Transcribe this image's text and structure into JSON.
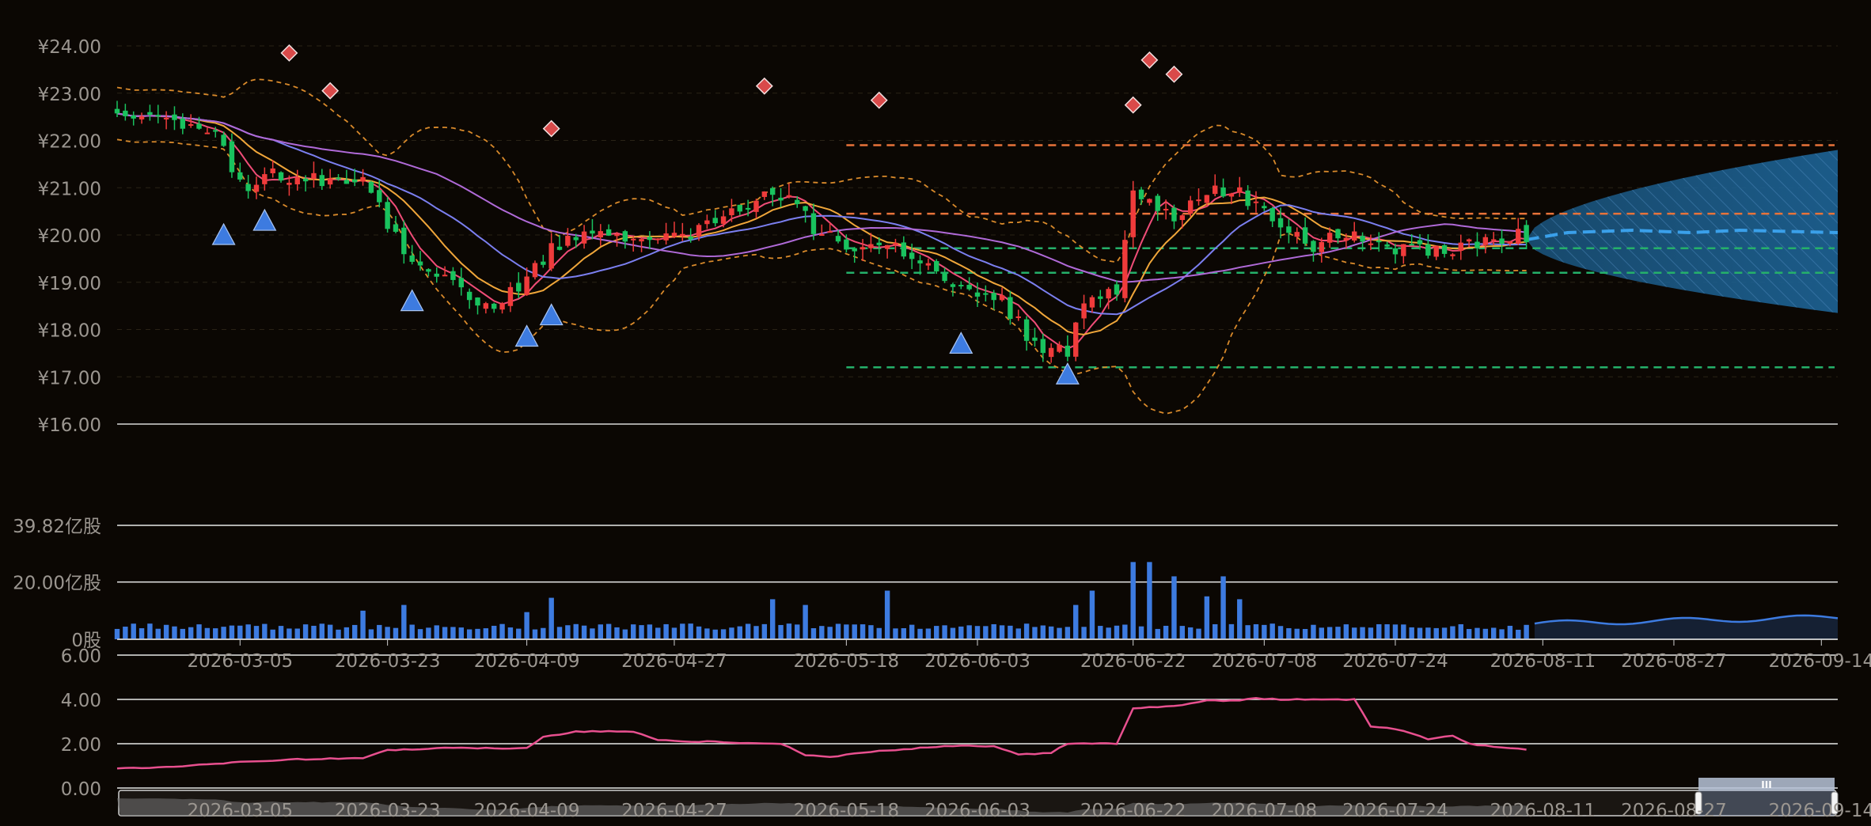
{
  "chart_data": [
    {
      "type": "candlestick",
      "panel": "price",
      "y_tick_labels": [
        "¥24.00",
        "¥23.00",
        "¥22.00",
        "¥21.00",
        "¥20.00",
        "¥19.00",
        "¥18.00",
        "¥17.00",
        "¥16.00"
      ],
      "ylim": [
        16,
        24
      ],
      "date_start": "2026-02-18",
      "date_end": "2026-09-16",
      "last_candle_date": "2026-08-09",
      "anchors": [
        [
          "2026-02-18",
          22.7
        ],
        [
          "2026-02-24",
          22.5
        ],
        [
          "2026-03-01",
          22.3
        ],
        [
          "2026-03-04",
          21.5
        ],
        [
          "2026-03-06",
          21.1
        ],
        [
          "2026-03-10",
          21.3
        ],
        [
          "2026-03-14",
          21.2
        ],
        [
          "2026-03-20",
          21.2
        ],
        [
          "2026-03-23",
          20.2
        ],
        [
          "2026-03-27",
          19.2
        ],
        [
          "2026-04-01",
          18.9
        ],
        [
          "2026-04-05",
          18.4
        ],
        [
          "2026-04-08",
          18.9
        ],
        [
          "2026-04-12",
          19.7
        ],
        [
          "2026-04-16",
          20.0
        ],
        [
          "2026-04-22",
          20.0
        ],
        [
          "2026-04-27",
          19.9
        ],
        [
          "2026-05-03",
          20.4
        ],
        [
          "2026-05-07",
          20.8
        ],
        [
          "2026-05-11",
          20.9
        ],
        [
          "2026-05-14",
          20.1
        ],
        [
          "2026-05-18",
          19.8
        ],
        [
          "2026-05-22",
          19.8
        ],
        [
          "2026-05-27",
          19.5
        ],
        [
          "2026-06-01",
          18.9
        ],
        [
          "2026-06-06",
          18.6
        ],
        [
          "2026-06-10",
          17.7
        ],
        [
          "2026-06-14",
          17.6
        ],
        [
          "2026-06-17",
          18.8
        ],
        [
          "2026-06-20",
          18.8
        ],
        [
          "2026-06-22",
          20.8
        ],
        [
          "2026-06-27",
          20.3
        ],
        [
          "2026-07-01",
          20.9
        ],
        [
          "2026-07-05",
          20.9
        ],
        [
          "2026-07-09",
          20.4
        ],
        [
          "2026-07-14",
          19.8
        ],
        [
          "2026-07-19",
          20.0
        ],
        [
          "2026-07-24",
          19.7
        ],
        [
          "2026-07-29",
          19.6
        ],
        [
          "2026-08-04",
          19.9
        ],
        [
          "2026-08-09",
          20.0
        ]
      ],
      "up_color": "#ef3b3b",
      "down_color": "#19c25e",
      "moving_average_colors": [
        "#f04d78",
        "#f0a63a",
        "#7b7ff0",
        "#b06ad8"
      ],
      "bollinger_color": "#d98a2b",
      "horizontal_levels": [
        {
          "value": 21.9,
          "color": "#e8733a",
          "from": "2026-05-18"
        },
        {
          "value": 20.45,
          "color": "#e8733a",
          "from": "2026-05-18"
        },
        {
          "value": 19.72,
          "color": "#25b06a",
          "from": "2026-05-18"
        },
        {
          "value": 19.2,
          "color": "#25b06a",
          "from": "2026-05-18"
        },
        {
          "value": 17.2,
          "color": "#25b06a",
          "from": "2026-05-18"
        }
      ],
      "forecast": {
        "from": "2026-08-09",
        "to": "2026-09-16",
        "center": [
          [
            "2026-08-09",
            19.9
          ],
          [
            "2026-08-14",
            20.05
          ],
          [
            "2026-08-22",
            20.1
          ],
          [
            "2026-08-29",
            20.05
          ],
          [
            "2026-09-04",
            20.1
          ],
          [
            "2026-09-16",
            20.05
          ]
        ],
        "upper_end": 21.8,
        "lower_end": 18.35,
        "line_color": "#3aa0ea",
        "band_color": "#1c5f8f"
      },
      "sell_signals": [
        [
          "2026-03-11",
          23.85
        ],
        [
          "2026-03-16",
          23.05
        ],
        [
          "2026-04-12",
          22.25
        ],
        [
          "2026-05-08",
          23.15
        ],
        [
          "2026-05-22",
          22.85
        ],
        [
          "2026-06-22",
          22.75
        ],
        [
          "2026-06-24",
          23.7
        ],
        [
          "2026-06-27",
          23.4
        ]
      ],
      "buy_signals": [
        [
          "2026-03-03",
          20.0
        ],
        [
          "2026-03-08",
          20.3
        ],
        [
          "2026-03-26",
          18.6
        ],
        [
          "2026-04-09",
          17.85
        ],
        [
          "2026-04-12",
          18.3
        ],
        [
          "2026-06-01",
          17.7
        ],
        [
          "2026-06-14",
          17.05
        ]
      ],
      "signal_colors": {
        "sell": "#d94a4a",
        "buy": "#3d7be0"
      }
    },
    {
      "type": "bar",
      "panel": "volume",
      "y_tick_labels": [
        "39.82亿股",
        "20.00亿股",
        "0股"
      ],
      "ylim": [
        0,
        39.82
      ],
      "bar_color": "#3d7be0",
      "baseline": 4.4,
      "spikes": [
        [
          "2026-03-20",
          10.0
        ],
        [
          "2026-03-25",
          12.0
        ],
        [
          "2026-04-09",
          9.5
        ],
        [
          "2026-04-12",
          14.5
        ],
        [
          "2026-05-09",
          14.0
        ],
        [
          "2026-05-13",
          12.0
        ],
        [
          "2026-05-23",
          17.0
        ],
        [
          "2026-06-15",
          12.0
        ],
        [
          "2026-06-17",
          17.0
        ],
        [
          "2026-06-22",
          27.0
        ],
        [
          "2026-06-24",
          27.0
        ],
        [
          "2026-06-27",
          22.0
        ],
        [
          "2026-07-01",
          15.0
        ],
        [
          "2026-07-03",
          22.0
        ],
        [
          "2026-07-05",
          14.0
        ]
      ],
      "forecast_from": "2026-08-10",
      "forecast_color": "#3d7be0"
    },
    {
      "type": "line",
      "panel": "indicator",
      "y_tick_labels": [
        "6.00",
        "4.00",
        "2.00",
        "0.00"
      ],
      "ylim": [
        0,
        6
      ],
      "line_color": "#e8508f",
      "series": [
        [
          "2026-02-18",
          0.9
        ],
        [
          "2026-02-25",
          0.95
        ],
        [
          "2026-03-02",
          1.1
        ],
        [
          "2026-03-06",
          1.2
        ],
        [
          "2026-03-12",
          1.3
        ],
        [
          "2026-03-20",
          1.35
        ],
        [
          "2026-03-23",
          1.7
        ],
        [
          "2026-03-30",
          1.8
        ],
        [
          "2026-04-04",
          1.8
        ],
        [
          "2026-04-09",
          1.8
        ],
        [
          "2026-04-11",
          2.3
        ],
        [
          "2026-04-15",
          2.55
        ],
        [
          "2026-04-22",
          2.55
        ],
        [
          "2026-04-25",
          2.15
        ],
        [
          "2026-05-05",
          2.05
        ],
        [
          "2026-05-10",
          2.0
        ],
        [
          "2026-05-13",
          1.5
        ],
        [
          "2026-05-16",
          1.4
        ],
        [
          "2026-05-20",
          1.6
        ],
        [
          "2026-05-30",
          1.9
        ],
        [
          "2026-06-05",
          1.9
        ],
        [
          "2026-06-08",
          1.5
        ],
        [
          "2026-06-12",
          1.6
        ],
        [
          "2026-06-14",
          2.0
        ],
        [
          "2026-06-20",
          2.0
        ],
        [
          "2026-06-22",
          3.6
        ],
        [
          "2026-06-27",
          3.7
        ],
        [
          "2026-07-01",
          3.95
        ],
        [
          "2026-07-05",
          3.95
        ],
        [
          "2026-07-07",
          4.05
        ],
        [
          "2026-07-10",
          4.0
        ],
        [
          "2026-07-15",
          4.0
        ],
        [
          "2026-07-19",
          4.0
        ],
        [
          "2026-07-21",
          2.8
        ],
        [
          "2026-07-25",
          2.6
        ],
        [
          "2026-07-28",
          2.2
        ],
        [
          "2026-07-31",
          2.35
        ],
        [
          "2026-08-02",
          2.0
        ],
        [
          "2026-08-05",
          1.85
        ],
        [
          "2026-08-09",
          1.75
        ]
      ]
    }
  ],
  "x_axis": {
    "tick_labels": [
      "2026-03-05",
      "2026-03-23",
      "2026-04-09",
      "2026-04-27",
      "2026-05-18",
      "2026-06-03",
      "2026-06-22",
      "2026-07-08",
      "2026-07-24",
      "2026-08-11",
      "2026-08-27",
      "2026-09-14"
    ]
  },
  "zoom_slider": {
    "handle_glyph": "III",
    "window_start": "2026-08-30",
    "window_end": "2026-09-16"
  },
  "colors": {
    "background": "#0b0703",
    "axis_text": "#9b9690",
    "grid_major": "#e8e8e8",
    "grid_minor": "#2a2316"
  }
}
